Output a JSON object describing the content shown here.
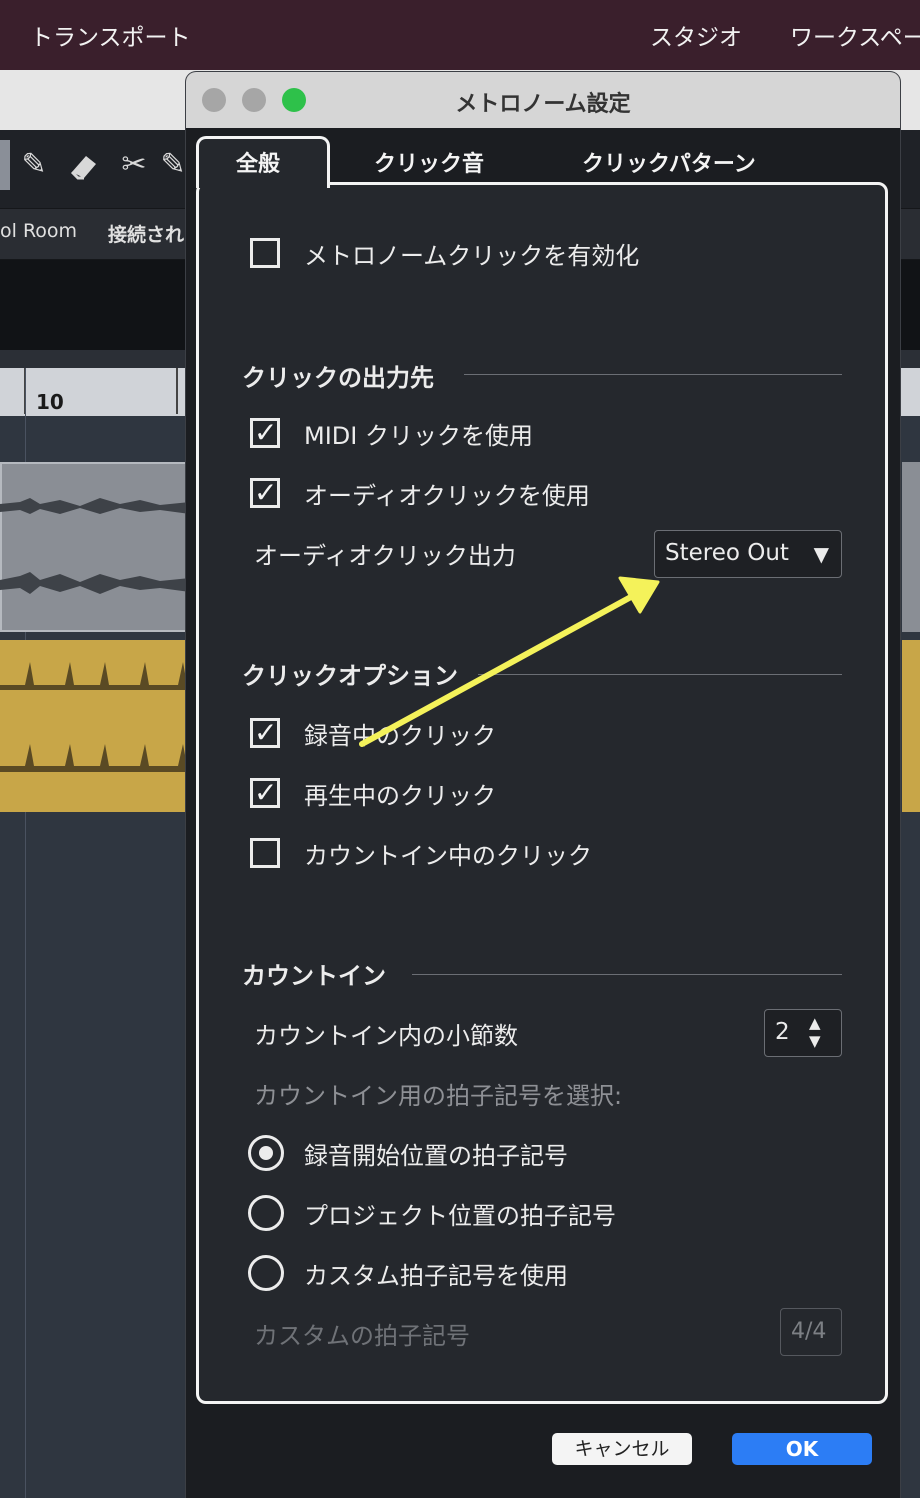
{
  "menubar": {
    "left_item": "トランスポート",
    "right_items": [
      "スタジオ",
      "ワークスペー"
    ]
  },
  "background": {
    "route_left": "ol Room",
    "route_status": "接続され",
    "ruler_number": "10",
    "tool_icons": [
      "pencil-icon",
      "eraser-icon",
      "scissors-icon"
    ]
  },
  "dialog": {
    "title": "メトロノーム設定",
    "tabs": [
      {
        "label": "全般",
        "active": true
      },
      {
        "label": "クリック音",
        "active": false
      },
      {
        "label": "クリックパターン",
        "active": false
      }
    ],
    "enable_click": {
      "label": "メトロノームクリックを有効化",
      "checked": false
    },
    "output_section": {
      "title": "クリックの出力先",
      "use_midi": {
        "label": "MIDI クリックを使用",
        "checked": true
      },
      "use_audio": {
        "label": "オーディオクリックを使用",
        "checked": true
      },
      "audio_output_label": "オーディオクリック出力",
      "audio_output_value": "Stereo Out"
    },
    "options_section": {
      "title": "クリックオプション",
      "items": [
        {
          "label": "録音中のクリック",
          "checked": true
        },
        {
          "label": "再生中のクリック",
          "checked": true
        },
        {
          "label": "カウントイン中のクリック",
          "checked": false
        }
      ]
    },
    "countin_section": {
      "title": "カウントイン",
      "bars_label": "カウントイン内の小節数",
      "bars_value": "2",
      "signature_prompt": "カウントイン用の拍子記号を選択:",
      "radios": [
        {
          "label": "録音開始位置の拍子記号",
          "selected": true
        },
        {
          "label": "プロジェクト位置の拍子記号",
          "selected": false
        },
        {
          "label": "カスタム拍子記号を使用",
          "selected": false
        }
      ],
      "custom_signature_label": "カスタムの拍子記号",
      "custom_signature_value": "4/4"
    },
    "buttons": {
      "cancel": "キャンセル",
      "ok": "OK"
    }
  },
  "colors": {
    "accent_ok": "#2c7df5",
    "traffic_green": "#2ec14a",
    "annotation_arrow": "#f4f25a",
    "midi_track": "#c8a648",
    "menubar": "#3a1f2c"
  }
}
